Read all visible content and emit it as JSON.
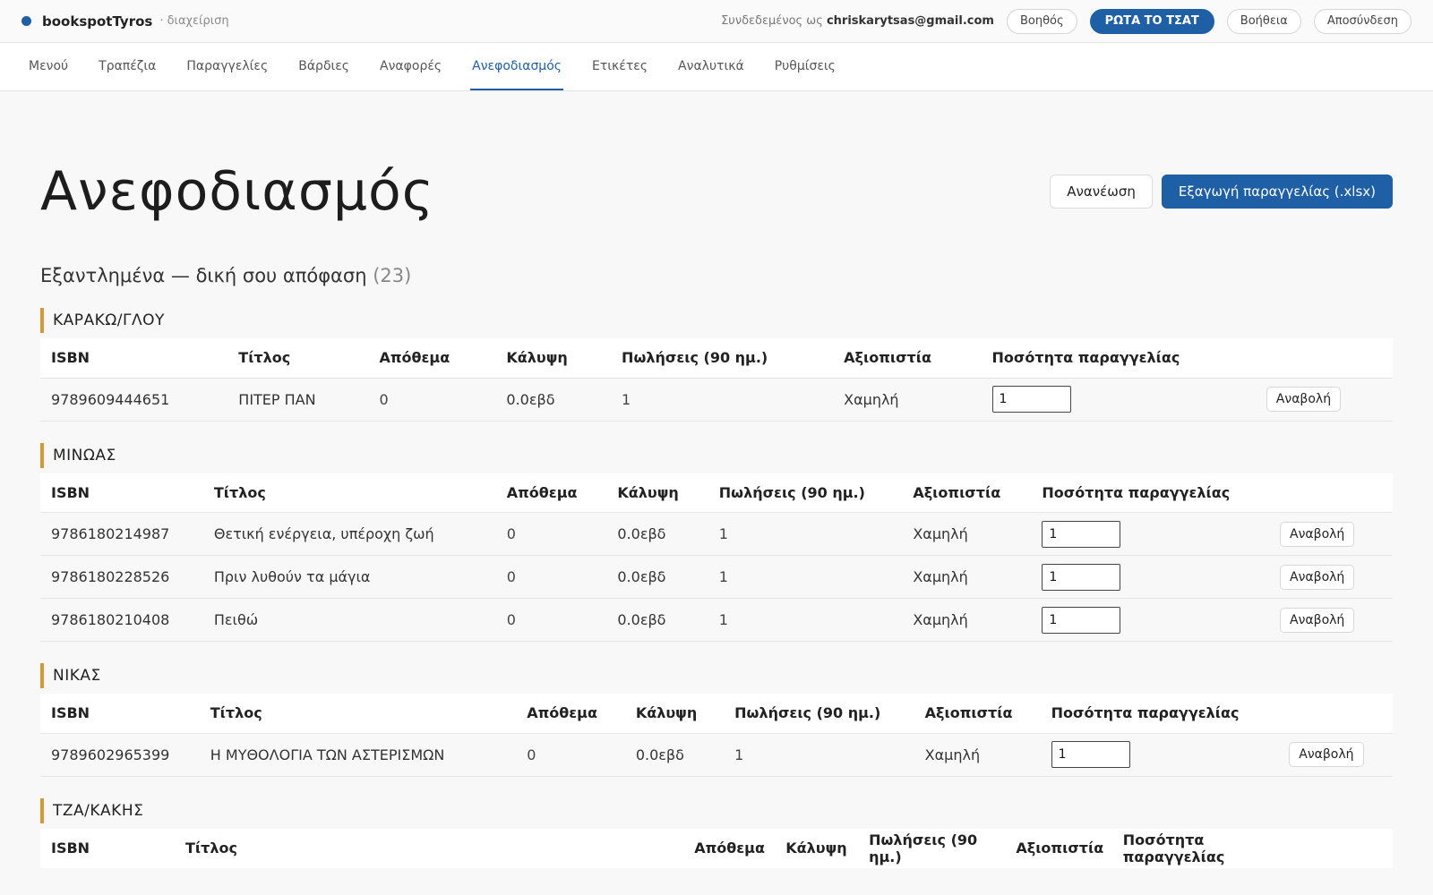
{
  "topbar": {
    "brand": "bookspotTyros",
    "brand_sub": "· διαχείριση",
    "logged_prefix": "Συνδεδεμένος ως",
    "user_email": "chriskarytsas@gmail.com",
    "assistant_label": "Βοηθός",
    "chat_label": "ΡΩΤΑ ΤΟ ΤΣΑΤ",
    "help_label": "Βοήθεια",
    "logout_label": "Αποσύνδεση",
    "brand_color": "#1f5fa6"
  },
  "nav": {
    "tabs": [
      {
        "label": "Μενού"
      },
      {
        "label": "Τραπέζια"
      },
      {
        "label": "Παραγγελίες"
      },
      {
        "label": "Βάρδιες"
      },
      {
        "label": "Αναφορές"
      },
      {
        "label": "Ανεφοδιασμός"
      },
      {
        "label": "Ετικέτες"
      },
      {
        "label": "Αναλυτικά"
      },
      {
        "label": "Ρυθμίσεις"
      }
    ],
    "active": "Ανεφοδιασμός"
  },
  "page": {
    "title": "Ανεφοδιασμός",
    "refresh_label": "Ανανέωση",
    "export_label": "Εξαγωγή παραγγελίας (.xlsx)",
    "section_title": "Εξαντλημένα — δική σου απόφαση",
    "section_count": "(23)"
  },
  "columns": {
    "isbn": "ISBN",
    "title": "Τίτλος",
    "stock": "Απόθεμα",
    "coverage": "Κάλυψη",
    "sales": "Πωλήσεις (90 ημ.)",
    "reliability": "Αξιοπιστία",
    "order_qty": "Ποσότητα παραγγελίας"
  },
  "defer_label": "Αναβολή",
  "groups": [
    {
      "name": "ΚΑΡΑΚΩ/ΓΛΟΥ",
      "rows": [
        {
          "isbn": "9789609444651",
          "title": "ΠΙΤΕΡ ΠΑΝ",
          "stock": "0",
          "coverage": "0.0εβδ",
          "sales": "1",
          "reliability": "Χαμηλή",
          "qty": "1"
        }
      ]
    },
    {
      "name": "ΜΙΝΩΑΣ",
      "rows": [
        {
          "isbn": "9786180214987",
          "title": "Θετική ενέργεια, υπέροχη ζωή",
          "stock": "0",
          "coverage": "0.0εβδ",
          "sales": "1",
          "reliability": "Χαμηλή",
          "qty": "1"
        },
        {
          "isbn": "9786180228526",
          "title": "Πριν λυθούν τα μάγια",
          "stock": "0",
          "coverage": "0.0εβδ",
          "sales": "1",
          "reliability": "Χαμηλή",
          "qty": "1"
        },
        {
          "isbn": "9786180210408",
          "title": "Πειθώ",
          "stock": "0",
          "coverage": "0.0εβδ",
          "sales": "1",
          "reliability": "Χαμηλή",
          "qty": "1"
        }
      ]
    },
    {
      "name": "ΝΙΚΑΣ",
      "rows": [
        {
          "isbn": "9789602965399",
          "title": "Η ΜΥΘΟΛΟΓΙΑ ΤΩΝ ΑΣΤΕΡΙΣΜΩΝ",
          "stock": "0",
          "coverage": "0.0εβδ",
          "sales": "1",
          "reliability": "Χαμηλή",
          "qty": "1"
        }
      ]
    },
    {
      "name": "ΤΖΑ/ΚΑΚΗΣ",
      "rows": []
    }
  ]
}
